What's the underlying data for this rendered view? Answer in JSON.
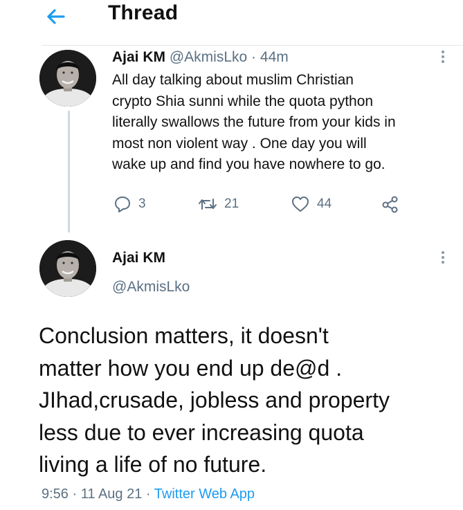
{
  "header": {
    "title": "Thread"
  },
  "parent_tweet": {
    "author_name": "Ajai KM",
    "handle": "@AkmisLko",
    "separator": "·",
    "time": "44m",
    "text": "All day talking about  muslim Christian\ncrypto Shia sunni while the quota python\nliterally swallows the future from your kids in\nmost non violent way . One day you will\nwake up and find you have nowhere to go.",
    "replies": "3",
    "retweets": "21",
    "likes": "44"
  },
  "main_tweet": {
    "author_name": "Ajai KM",
    "handle": "@AkmisLko",
    "text": "Conclusion matters, it doesn't\nmatter how you end up de@d .\nJIhad,crusade, jobless and property\nless due to ever increasing quota\nliving a life of no future.",
    "time": "9:56",
    "date": "11 Aug 21",
    "app": "Twitter Web App",
    "separator": "·"
  },
  "colors": {
    "accent": "#1d9bf0",
    "muted": "#5b7083",
    "divider": "#e3e7ea"
  }
}
